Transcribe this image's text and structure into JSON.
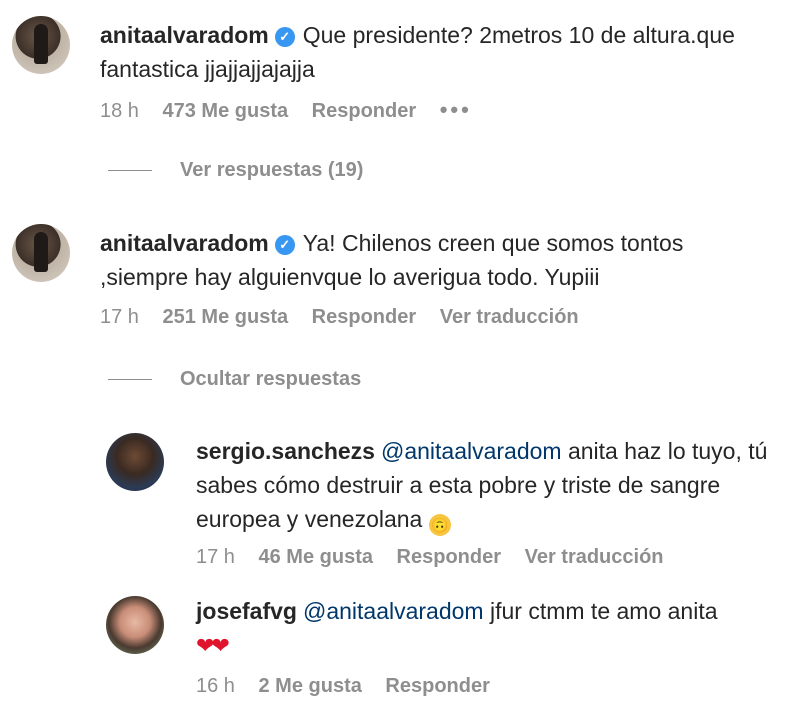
{
  "comments": [
    {
      "username": "anitaalvaradom",
      "verified": true,
      "text": "Que presidente? 2metros 10 de altura.que fantastica jjajjajjajajja",
      "time": "18 h",
      "likes": "473 Me gusta",
      "reply": "Responder",
      "more": "•••",
      "toggle": "Ver respuestas (19)"
    },
    {
      "username": "anitaalvaradom",
      "verified": true,
      "text": "Ya! Chilenos creen que somos tontos ,siempre hay alguienvque lo averigua todo. Yupiii",
      "time": "17 h",
      "likes": "251 Me gusta",
      "reply": "Responder",
      "translate": "Ver traducción",
      "toggle": "Ocultar respuestas"
    }
  ],
  "replies": [
    {
      "username": "sergio.sanchezs",
      "mention": "@anitaalvaradom",
      "text": "anita haz lo tuyo, tú sabes cómo destruir a esta pobre y triste de sangre europea y venezolana",
      "emoji": "🙃",
      "time": "17 h",
      "likes": "46 Me gusta",
      "reply": "Responder",
      "translate": "Ver traducción"
    },
    {
      "username": "josefafvg",
      "mention": "@anitaalvaradom",
      "text": "jfur ctmm te amo anita",
      "emoji": "❤❤",
      "time": "16 h",
      "likes": "2 Me gusta",
      "reply": "Responder"
    }
  ],
  "verified_glyph": "✓",
  "colors": {
    "verified": "#3897f0",
    "mention": "#00376b",
    "meta": "#8e8e8e",
    "heart": "#e0152d"
  }
}
